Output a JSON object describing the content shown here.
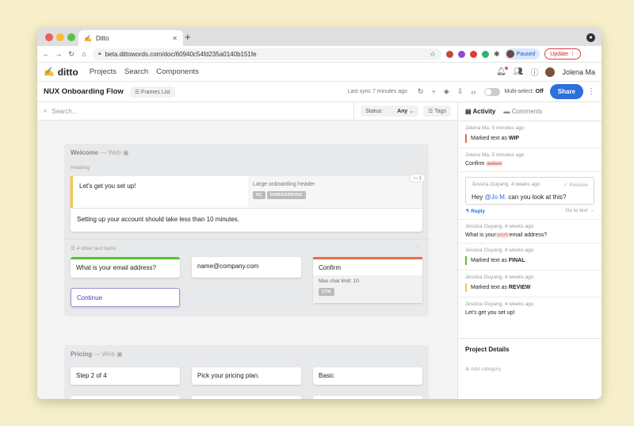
{
  "browser": {
    "tab_title": "Ditto",
    "url": "beta.dittowords.com/doc/60940c54fd235a0140b151fe",
    "profile_status": "Paused",
    "update_label": "Update"
  },
  "app": {
    "brand": "ditto",
    "nav": [
      "Projects",
      "Search",
      "Components"
    ],
    "user_name": "Jolena Ma"
  },
  "toolbar": {
    "doc_title": "NUX Onboarding Flow",
    "frames_list": "Frames List",
    "last_sync": "Last sync 7 minutes ago",
    "multi_select_label": "Multi-select:",
    "multi_select_value": "Off",
    "share_label": "Share"
  },
  "filters": {
    "search_placeholder": "Search...",
    "status_label": "Status:",
    "status_value": "Any",
    "tags_label": "Tags"
  },
  "frames": [
    {
      "name": "Welcome",
      "platform": "Web",
      "heading_label": "Heading",
      "heading_text": "Let's get you set up!",
      "heading_note": "Large onboarding header",
      "heading_chips": [
        "H1",
        "ONBOARDING"
      ],
      "subheading_text": "Setting up your account should take less than 10 minutes.",
      "comment_count": "1",
      "other_items_label": "4 other text items",
      "items": [
        {
          "text": "What is your email address?"
        },
        {
          "text": "name@company.com"
        },
        {
          "text": "Confirm",
          "char_limit": "Max char limit: 10",
          "tag": "CTA"
        },
        {
          "text": "Continue"
        }
      ]
    },
    {
      "name": "Pricing",
      "platform": "Web",
      "items": [
        {
          "text": "Step 2 of 4"
        },
        {
          "text": "Pick your pricing plan."
        },
        {
          "text": "Basic"
        }
      ]
    }
  ],
  "sidebar": {
    "tabs": [
      "Activity",
      "Comments"
    ],
    "activity": [
      {
        "meta": "Jolena Ma, 5 minutes ago",
        "prefix": "Marked text as ",
        "status": "WIP",
        "color": "#ec6b4a"
      },
      {
        "meta": "Jolena Ma, 5 minutes ago",
        "text": "Confirm",
        "removed": "action"
      },
      {
        "meta": "Jessica Ouyang, 4 weeks ago",
        "pre": "What is your ",
        "removed": "work",
        "post": " email address?"
      },
      {
        "meta": "Jessica Ouyang, 4 weeks ago",
        "prefix": "Marked text as ",
        "status": "FINAL",
        "color": "#54c12e"
      },
      {
        "meta": "Jessica Ouyang, 4 weeks ago",
        "prefix": "Marked text as ",
        "status": "REVIEW",
        "color": "#f5c842"
      },
      {
        "meta": "Jessica Ouyang, 4 weeks ago",
        "text": "Let's get you set up",
        "suffix": "!"
      }
    ],
    "thread": {
      "meta": "Jessica Ouyang, 4 weeks ago",
      "resolve": "✓ Resolve",
      "msg_pre": "Hey ",
      "mention": "@Jo M.",
      "msg_post": " can you look at this?",
      "reply": "Reply",
      "goto": "Go to text"
    },
    "project_details": "Project Details",
    "add_category": "Add category"
  }
}
